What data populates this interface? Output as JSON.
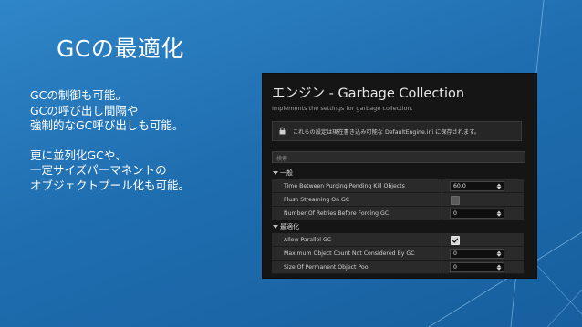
{
  "slide": {
    "title": "GCの最適化",
    "bullets": [
      "GCの制御も可能。",
      "GCの呼び出し間隔や",
      "強制的なGC呼び出しも可能。",
      "",
      "更に並列化GCや、",
      "一定サイズパーマネントの",
      "オブジェクトプール化も可能。"
    ]
  },
  "panel": {
    "title": "エンジン - Garbage Collection",
    "subtitle": "Implements the settings for garbage collection.",
    "notice": "これらの設定は現在書き込み可能な DefaultEngine.ini に保存されます。",
    "search_placeholder": "検索",
    "categories": [
      {
        "label": "一般",
        "rows": [
          {
            "name": "Time Between Purging Pending Kill Objects",
            "kind": "number",
            "value": "60.0"
          },
          {
            "name": "Flush Streaming On GC",
            "kind": "checkbox",
            "checked": false
          },
          {
            "name": "Number Of Retries Before Forcing GC",
            "kind": "number",
            "value": "0"
          }
        ]
      },
      {
        "label": "最適化",
        "rows": [
          {
            "name": "Allow Parallel GC",
            "kind": "checkbox",
            "checked": true
          },
          {
            "name": "Maximum Object Count Not Considered By GC",
            "kind": "number",
            "value": "0"
          },
          {
            "name": "Size Of Permanent Object Pool",
            "kind": "number",
            "value": "0"
          }
        ]
      }
    ]
  },
  "colors": {
    "background": "#1f6eb0",
    "panel": "#151515",
    "row": "#2a2a2a",
    "text_light": "#ffffff"
  }
}
